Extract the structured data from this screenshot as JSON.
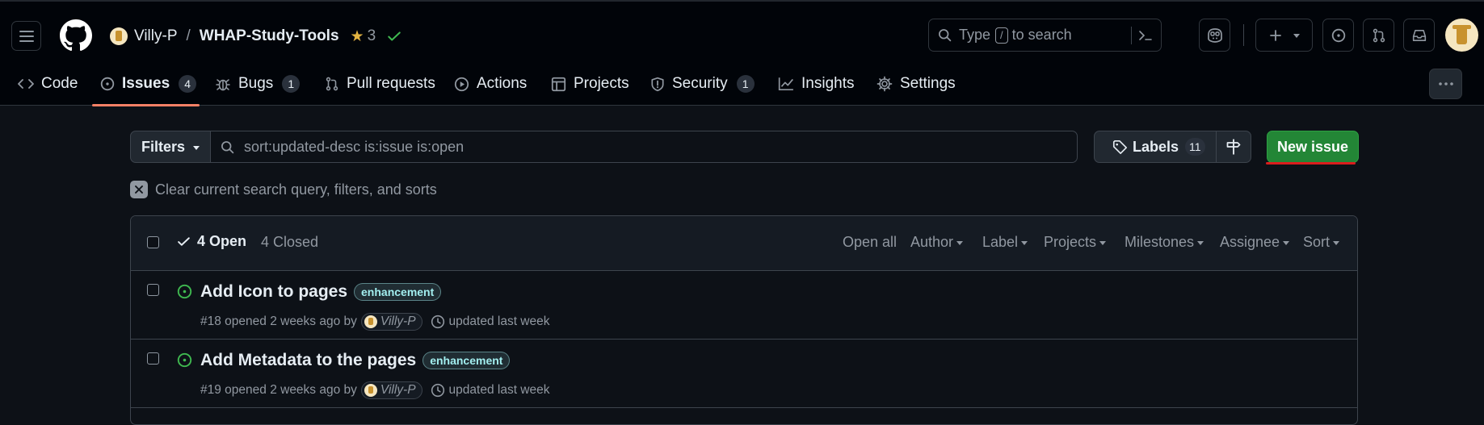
{
  "repo": {
    "owner": "Villy-P",
    "separator": "/",
    "name": "WHAP-Study-Tools",
    "stars": "3"
  },
  "global_search": {
    "prefix": "Type",
    "key": "/",
    "suffix": "to search"
  },
  "tabs": [
    {
      "label": "Code",
      "icon": "code-icon"
    },
    {
      "label": "Issues",
      "count": "4",
      "icon": "issue-opened-icon",
      "selected": true
    },
    {
      "label": "Bugs",
      "count": "1",
      "icon": "bug-icon"
    },
    {
      "label": "Pull requests",
      "icon": "git-pull-request-icon"
    },
    {
      "label": "Actions",
      "icon": "play-icon"
    },
    {
      "label": "Projects",
      "icon": "table-icon"
    },
    {
      "label": "Security",
      "count": "1",
      "icon": "shield-icon"
    },
    {
      "label": "Insights",
      "icon": "graph-icon"
    },
    {
      "label": "Settings",
      "icon": "gear-icon"
    }
  ],
  "toolbar": {
    "filters_label": "Filters",
    "query": "sort:updated-desc is:issue is:open",
    "labels_label": "Labels",
    "labels_count": "11",
    "new_issue_label": "New issue"
  },
  "clear_query_label": "Clear current search query, filters, and sorts",
  "list_header": {
    "open_label": "4 Open",
    "closed_label": "4 Closed",
    "open_all": "Open all",
    "filters": [
      "Author",
      "Label",
      "Projects",
      "Milestones",
      "Assignee",
      "Sort"
    ]
  },
  "issues": [
    {
      "title": "Add Icon to pages",
      "label": "enhancement",
      "number_text": "#18 opened 2 weeks ago by",
      "author": "Villy-P",
      "updated": "updated last week"
    },
    {
      "title": "Add Metadata to the pages",
      "label": "enhancement",
      "number_text": "#19 opened 2 weeks ago by",
      "author": "Villy-P",
      "updated": "updated last week"
    }
  ],
  "colors": {
    "accent_green": "#238636",
    "underline_orange": "#f78166",
    "annotation_red": "#da1d1d",
    "label_cyan": "#a2eeef",
    "open_icon_green": "#3fb950"
  }
}
